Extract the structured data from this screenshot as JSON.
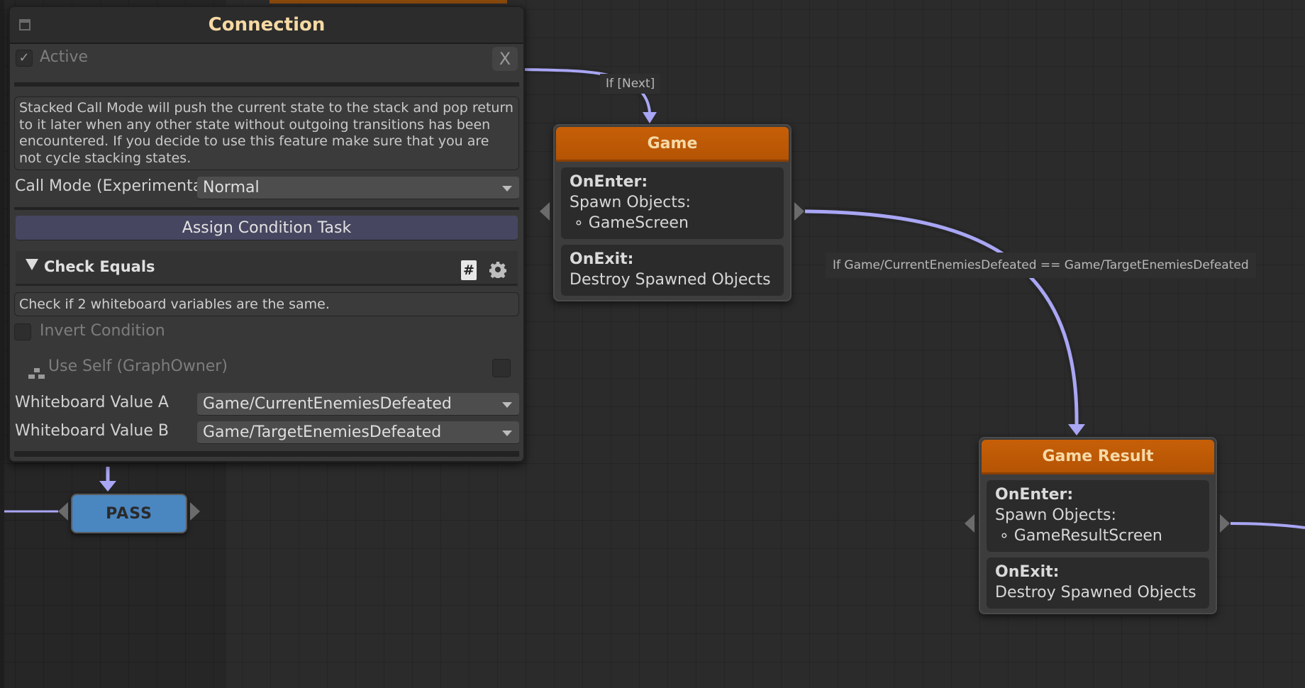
{
  "panel": {
    "title": "Connection",
    "active_label": "Active",
    "active_checked": true,
    "close_label": "X",
    "help_text": "Stacked Call Mode will push the current state to the stack and pop return to it later when any other state without outgoing transitions has been encountered. If you decide to use this feature make sure that you are not cycle stacking states.",
    "call_mode_label": "Call Mode (Experimental)",
    "call_mode_value": "Normal",
    "assign_button": "Assign Condition Task",
    "task": {
      "title": "Check Equals",
      "hash_icon": "#",
      "description": "Check if 2 whiteboard variables are the same.",
      "invert_label": "Invert Condition",
      "invert_checked": false,
      "use_self_label": "Use Self (GraphOwner)",
      "use_self_checked": false,
      "fields": [
        {
          "label": "Whiteboard Value A",
          "value": "Game/CurrentEnemiesDefeated"
        },
        {
          "label": "Whiteboard Value B",
          "value": "Game/TargetEnemiesDefeated"
        }
      ]
    }
  },
  "graph": {
    "nodes": [
      {
        "title": "Game",
        "on_enter_label": "OnEnter:",
        "on_enter_action": "Spawn Objects:",
        "on_enter_item": "∘ GameScreen",
        "on_exit_label": "OnExit:",
        "on_exit_action": "Destroy Spawned Objects"
      },
      {
        "title": "Game Result",
        "on_enter_label": "OnEnter:",
        "on_enter_action": "Spawn Objects:",
        "on_enter_item": "∘ GameResultScreen",
        "on_exit_label": "OnExit:",
        "on_exit_action": "Destroy Spawned Objects"
      }
    ],
    "pass_node": "PASS",
    "edge_labels": {
      "next": "If [Next]",
      "condition": "If Game/CurrentEnemiesDefeated == Game/TargetEnemiesDefeated"
    },
    "colors": {
      "edge": "#a9a6f5",
      "state_header": "#c05a06",
      "pass_node": "#4a86c0",
      "title_text": "#f6d9a3"
    }
  }
}
